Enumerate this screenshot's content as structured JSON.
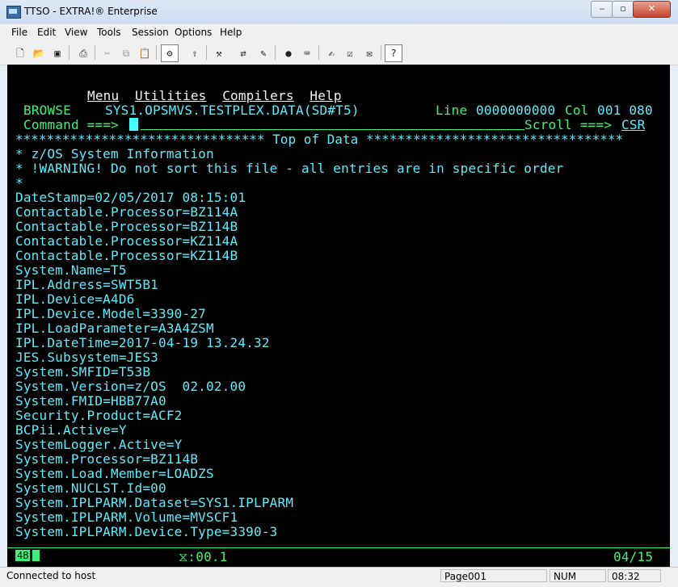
{
  "window": {
    "title": "TTSO - EXTRA!® Enterprise",
    "min": "‒",
    "max": "▫",
    "close": "✕"
  },
  "menu": [
    "File",
    "Edit",
    "View",
    "Tools",
    "Session",
    "Options",
    "Help"
  ],
  "toolbar": [
    "new-icon",
    "open-icon",
    "save-icon",
    "print-icon",
    "cut-icon",
    "copy-icon",
    "paste-icon",
    "macro-icon",
    "export-icon",
    "tools-icon",
    "transfer-icon",
    "edit-icon",
    "record-icon",
    "play-icon",
    "quickpad-icon",
    "display-icon",
    "keyboard-icon",
    "help-icon"
  ],
  "terminal": {
    "ispf_menu": [
      "Menu",
      "Utilities",
      "Compilers",
      "Help"
    ],
    "browse_label": "BROWSE",
    "dataset": "SYS1.OPSMVS.TESTPLEX.DATA(SD#T5)",
    "line_label": "Line",
    "line_value": "0000000000",
    "col_label": "Col",
    "col_value": "001 080",
    "command_label": "Command ===>",
    "scroll_label": "Scroll ===>",
    "scroll_value": "CSR",
    "top_of_data": "******************************** Top of Data *********************************",
    "lines": [
      "* z/OS System Information",
      "* !WARNING! Do not sort this file - all entries are in specific order",
      "*",
      "DateStamp=02/05/2017 08:15:01",
      "Contactable.Processor=BZ114A",
      "Contactable.Processor=BZ114B",
      "Contactable.Processor=KZ114A",
      "Contactable.Processor=KZ114B",
      "System.Name=T5",
      "IPL.Address=SWT5B1",
      "IPL.Device=A4D6",
      "IPL.Device.Model=3390-27",
      "IPL.LoadParameter=A3A4ZSM",
      "IPL.DateTime=2017-04-19 13.24.32",
      "JES.Subsystem=JES3",
      "System.SMFID=T53B",
      "System.Version=z/OS  02.02.00",
      "System.FMID=HBB77A0",
      "Security.Product=ACF2",
      "BCPii.Active=Y",
      "SystemLogger.Active=Y",
      "System.Processor=BZ114B",
      "System.Load.Member=LOADZS",
      "System.NUCLST.Id=00",
      "System.IPLPARM.Dataset=SYS1.IPLPARM",
      "System.IPLPARM.Volume=MVSCF1",
      "System.IPLPARM.Device.Type=3390-3"
    ],
    "oia_left": "4B",
    "oia_timer": "⧖:00.1",
    "oia_position": "04/15"
  },
  "statusbar": {
    "connection": "Connected to host",
    "page": "Page001",
    "num": "NUM",
    "time": "08:32"
  }
}
